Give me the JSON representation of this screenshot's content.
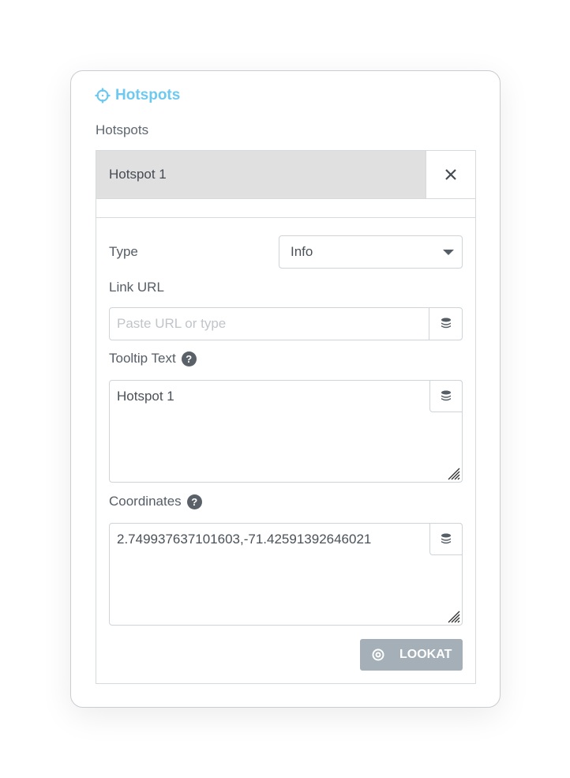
{
  "section": {
    "title": "Hotspots",
    "icon": "crosshair-icon",
    "accent_color": "#6ec9f0"
  },
  "control": {
    "label": "Hotspots"
  },
  "item": {
    "title": "Hotspot 1",
    "remove_icon": "close-icon",
    "fields": {
      "type": {
        "label": "Type",
        "value": "Info"
      },
      "link_url": {
        "label": "Link URL",
        "value": "",
        "placeholder": "Paste URL or type",
        "dynamic_icon": "database-icon"
      },
      "tooltip_text": {
        "label": "Tooltip Text",
        "help_icon": "?",
        "value": "Hotspot 1",
        "dynamic_icon": "database-icon"
      },
      "coordinates": {
        "label": "Coordinates",
        "help_icon": "?",
        "value": "2.749937637101603,-71.42591392646021",
        "dynamic_icon": "database-icon"
      }
    },
    "lookat_button": {
      "label": "LOOKAT",
      "icon": "target-icon",
      "color": "#a4afb7"
    }
  }
}
